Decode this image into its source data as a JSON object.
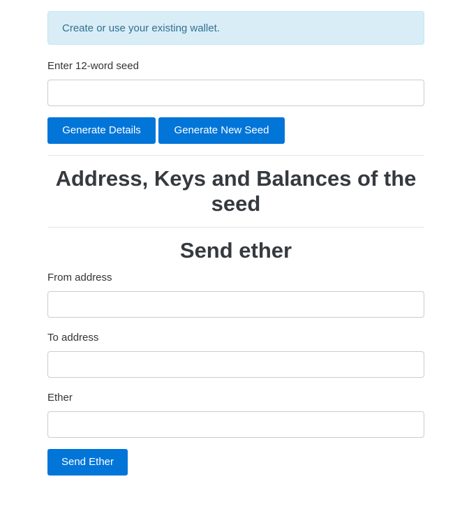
{
  "alert": {
    "text": "Create or use your existing wallet."
  },
  "seed_form": {
    "label": "Enter 12-word seed",
    "value": "",
    "placeholder": "",
    "generate_details_label": "Generate Details",
    "generate_new_seed_label": "Generate New Seed"
  },
  "details_section": {
    "title": "Address, Keys and Balances of the seed"
  },
  "send_section": {
    "title": "Send ether",
    "from_label": "From address",
    "from_value": "",
    "to_label": "To address",
    "to_value": "",
    "ether_label": "Ether",
    "ether_value": "",
    "send_button_label": "Send Ether"
  },
  "colors": {
    "primary": "#0275d8",
    "alert_bg": "#d9edf7",
    "alert_text": "#31708f",
    "heading": "#363a3f"
  }
}
